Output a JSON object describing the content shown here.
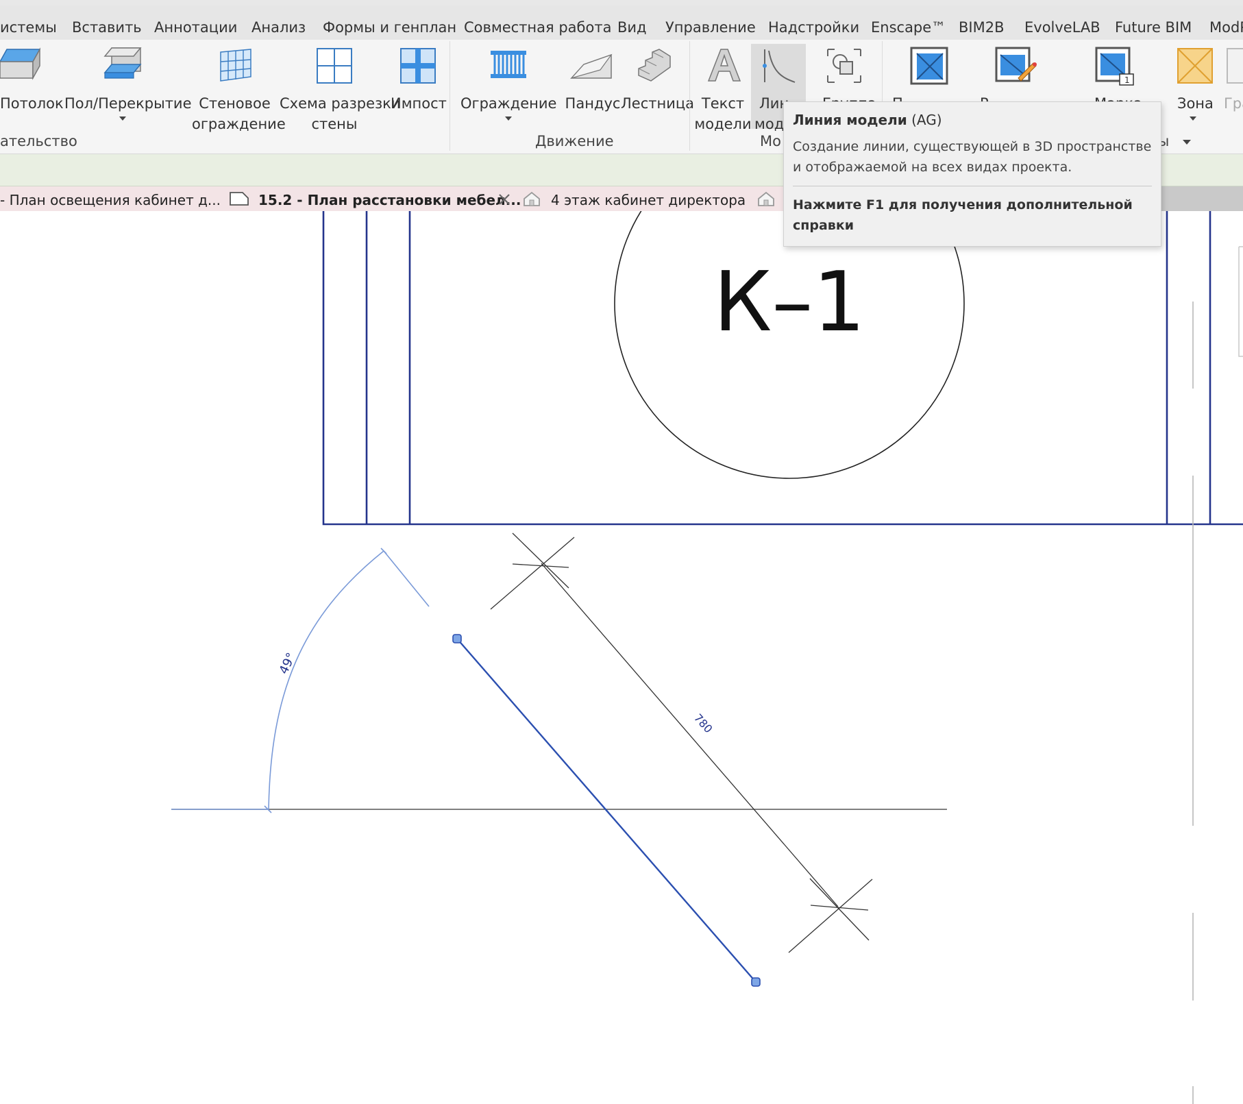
{
  "menu_tabs": [
    "истемы",
    "Вставить",
    "Аннотации",
    "Анализ",
    "Формы и генплан",
    "Совместная работа",
    "Вид",
    "Управление",
    "Надстройки",
    "Enscape™",
    "BIM2B",
    "EvolveLAB",
    "Future BIM",
    "ModP"
  ],
  "ribbon": {
    "ceiling": "Потолок",
    "floor": "Пол/Перекрытие",
    "curtain_wall_1": "Стеновое",
    "curtain_wall_2": "ограждение",
    "curtain_grid_1": "Схема разрезки",
    "curtain_grid_2": "стены",
    "mullion": "Импост",
    "railing": "Ограждение",
    "ramp": "Пандус",
    "stair": "Лестница",
    "model_text_1": "Текст",
    "model_text_2": "модели",
    "model_line_1": "Лин",
    "model_line_2": "моде",
    "group": "Группа",
    "room": "П",
    "room_sep": "Р",
    "tag": "Марка",
    "area": "Зона",
    "area_boundary": "Гра",
    "panel_build": "ательство",
    "panel_circulation": "Движение",
    "panel_model": "Мо",
    "panel_rooms": "ны"
  },
  "view_tabs": {
    "tab1": "- План освещения кабинет д...",
    "tab2": "15.2 - План расстановки мебел...",
    "tab3": "4 этаж кабинет директора"
  },
  "tooltip": {
    "title": "Линия модели",
    "shortcut": "(AG)",
    "description": "Создание линии, существующей в 3D пространстве и отображаемой на всех видах проекта.",
    "help": "Нажмите F1 для получения дополнительной справки"
  },
  "drawing": {
    "room_tag": "К–1",
    "angle_label": "49°",
    "length_label": "780"
  },
  "colors": {
    "wall_line": "#24348c",
    "selected_line": "#2b4fb0",
    "dim_line": "#7a9ad8",
    "accent_blue": "#3a8ee0"
  }
}
